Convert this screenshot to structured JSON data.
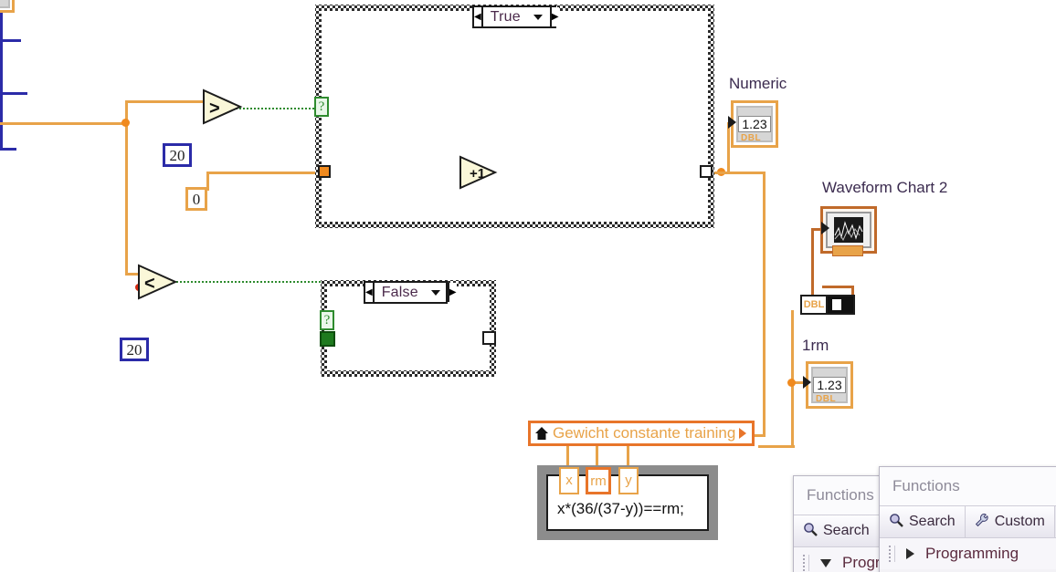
{
  "app": {
    "type": "labview-block-diagram"
  },
  "colors": {
    "wire_numeric": "#E8A349",
    "wire_blue": "#2B2BA8",
    "wire_boolean": "#2E8B2E",
    "junction": "#F08A1E",
    "subvi_border": "#E8752A",
    "label_text": "#3b2b4f"
  },
  "case_structures": [
    {
      "name": "true-case",
      "selector_value": "True",
      "left_arrow": "◀",
      "right_arrow": "▶",
      "selector_terminal": "?"
    },
    {
      "name": "false-case",
      "selector_value": "False",
      "left_arrow": "◀",
      "right_arrow": "▶",
      "selector_terminal": "?"
    }
  ],
  "nodes": {
    "greater_than": {
      "glyph": ">",
      "name": "greater-than-function"
    },
    "less_than": {
      "glyph": "<",
      "name": "less-than-function"
    },
    "increment": {
      "glyph": "+1",
      "name": "increment-function"
    }
  },
  "constants": [
    {
      "name": "constant-20-upper",
      "value": "20",
      "style": "blue"
    },
    {
      "name": "constant-0",
      "value": "0",
      "style": "orange"
    },
    {
      "name": "constant-20-lower",
      "value": "20",
      "style": "blue"
    }
  ],
  "indicators": [
    {
      "name": "numeric-indicator",
      "label": "Numeric",
      "value": "1.23",
      "datatype": "DBL"
    },
    {
      "name": "onerm-indicator",
      "label": "1rm",
      "value": "1.23",
      "datatype": "DBL"
    }
  ],
  "chart": {
    "label": "Waveform Chart 2",
    "name": "waveform-chart-2-terminal"
  },
  "conversion_node": {
    "label": "DBL",
    "name": "to-double-conversion"
  },
  "subvi": {
    "title": "Gewicht constante training",
    "home_icon": "home-icon",
    "expand_arrow": "▶"
  },
  "formula_node": {
    "expression": "x*(36/(37-y))==rm;",
    "terminals": [
      {
        "label": "x",
        "selected": false
      },
      {
        "label": "rm",
        "selected": true
      },
      {
        "label": "y",
        "selected": false
      }
    ]
  },
  "palettes": [
    {
      "name": "functions-palette-back",
      "title": "Functions",
      "search_label": "Search",
      "tree_label": "Progra",
      "tree_caret": "down"
    },
    {
      "name": "functions-palette-front",
      "title": "Functions",
      "search_label": "Search",
      "customize_label": "Custom",
      "tree_label": "Programming",
      "tree_caret": "right"
    }
  ]
}
